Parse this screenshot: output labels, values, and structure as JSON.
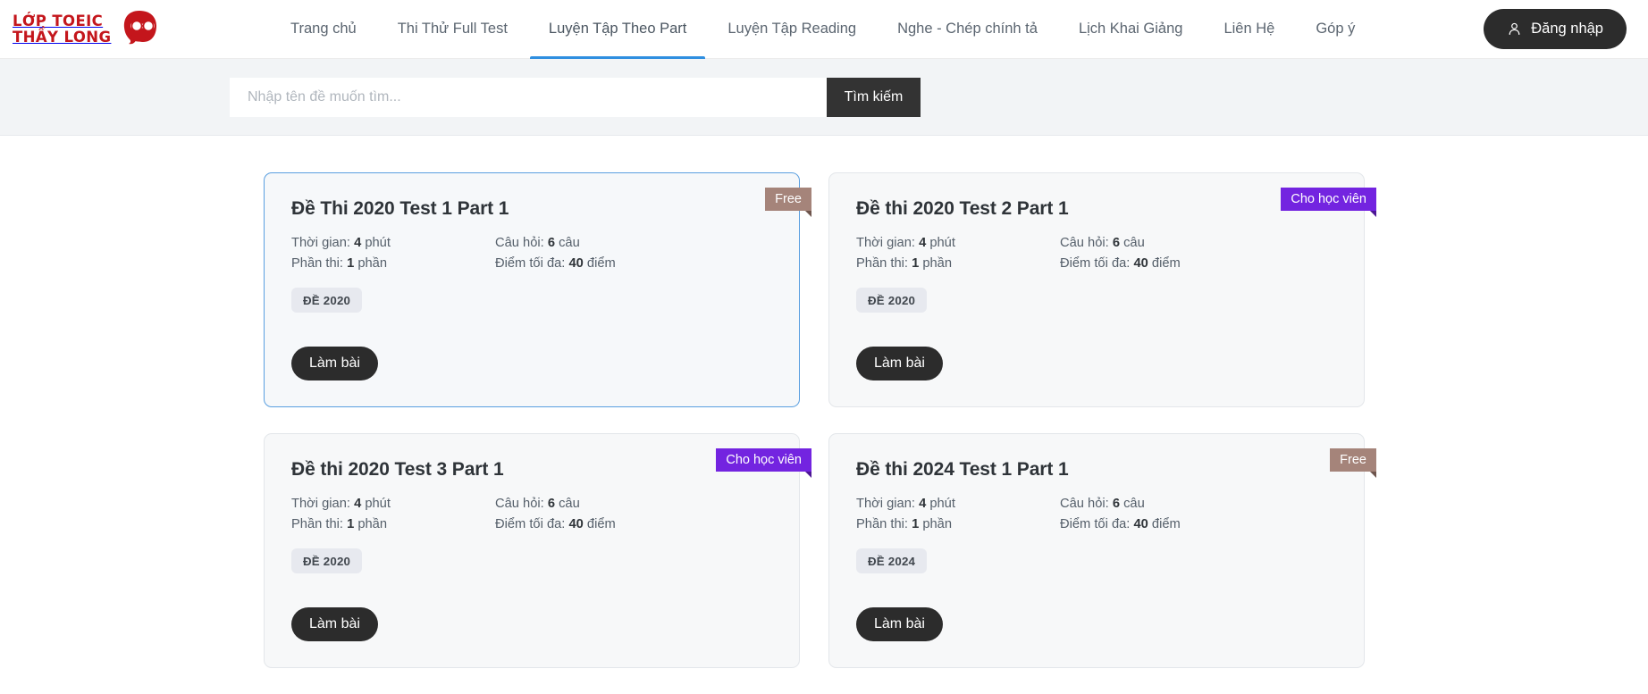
{
  "header": {
    "brand": {
      "line1": "LỚP TOEIC",
      "line2": "THẦY LONG",
      "color": "#c4161c"
    },
    "nav": [
      {
        "label": "Trang chủ",
        "active": false
      },
      {
        "label": "Thi Thử Full Test",
        "active": false
      },
      {
        "label": "Luyện Tập Theo Part",
        "active": true
      },
      {
        "label": "Luyện Tập Reading",
        "active": false
      },
      {
        "label": "Nghe - Chép chính tả",
        "active": false
      },
      {
        "label": "Lịch Khai Giảng",
        "active": false
      },
      {
        "label": "Liên Hệ",
        "active": false
      },
      {
        "label": "Góp ý",
        "active": false
      }
    ],
    "active_underline_color": "#2f8fe0",
    "login": {
      "label": "Đăng nhập",
      "icon": "user-icon",
      "bg": "#2c2c2c"
    }
  },
  "search": {
    "placeholder": "Nhập tên đề muốn tìm...",
    "value": "",
    "button_label": "Tìm kiếm",
    "button_bg": "#333333",
    "band_bg": "#f2f4f6"
  },
  "labels": {
    "time": "Thời gian:",
    "time_unit": "phút",
    "questions": "Câu hỏi:",
    "questions_unit": "câu",
    "parts": "Phần thi:",
    "parts_unit": "phần",
    "max_score": "Điểm tối đa:",
    "max_score_unit": "điểm",
    "action": "Làm bài"
  },
  "badge_colors": {
    "free": "#a5847a",
    "member": "#7324e0"
  },
  "cards": [
    {
      "title": "Đề Thi 2020 Test 1 Part 1",
      "badge": "Free",
      "badge_type": "free",
      "time": "4",
      "questions": "6",
      "parts": "1",
      "max_score": "40",
      "tag": "ĐỀ 2020",
      "action": "Làm bài",
      "selected": true
    },
    {
      "title": "Đề thi 2020 Test 2 Part 1",
      "badge": "Cho học viên",
      "badge_type": "member",
      "time": "4",
      "questions": "6",
      "parts": "1",
      "max_score": "40",
      "tag": "ĐỀ 2020",
      "action": "Làm bài",
      "selected": false
    },
    {
      "title": "Đề thi 2020 Test 3 Part 1",
      "badge": "Cho học viên",
      "badge_type": "member",
      "time": "4",
      "questions": "6",
      "parts": "1",
      "max_score": "40",
      "tag": "ĐỀ 2020",
      "action": "Làm bài",
      "selected": false
    },
    {
      "title": "Đề thi 2024 Test 1 Part 1",
      "badge": "Free",
      "badge_type": "free",
      "time": "4",
      "questions": "6",
      "parts": "1",
      "max_score": "40",
      "tag": "ĐỀ 2024",
      "action": "Làm bài",
      "selected": false
    }
  ]
}
